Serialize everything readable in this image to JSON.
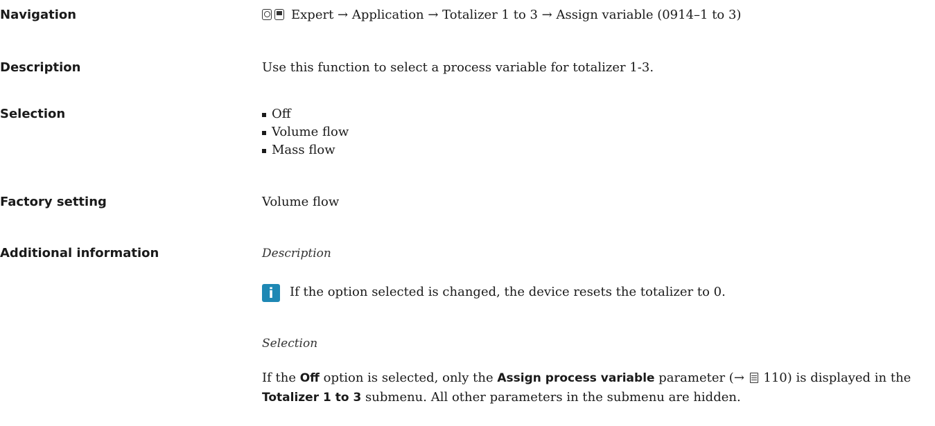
{
  "navigation": {
    "label": "Navigation",
    "path": "Expert → Application → Totalizer 1 to 3 → Assign variable (0914–1 to 3)"
  },
  "description": {
    "label": "Description",
    "text": "Use this function to select a process variable for totalizer 1-3."
  },
  "selection": {
    "label": "Selection",
    "options": [
      "Off",
      "Volume flow",
      "Mass flow"
    ]
  },
  "factory_setting": {
    "label": "Factory setting",
    "value": "Volume flow"
  },
  "additional_information": {
    "label": "Additional information",
    "description_heading": "Description",
    "info_icon": "info-icon",
    "note": "If the option selected is changed, the device resets the totalizer to 0.",
    "selection_heading": "Selection",
    "para_1": "If the ",
    "off_bold": "Off",
    "para_2": " option is selected, only the ",
    "assign_bold": "Assign process variable",
    "para_3": " parameter (→ ",
    "page_ref": "110",
    "para_4": ") is displayed in the ",
    "totalizer_bold": "Totalizer 1 to 3",
    "para_5": " submenu. All other parameters in the submenu are hidden."
  }
}
